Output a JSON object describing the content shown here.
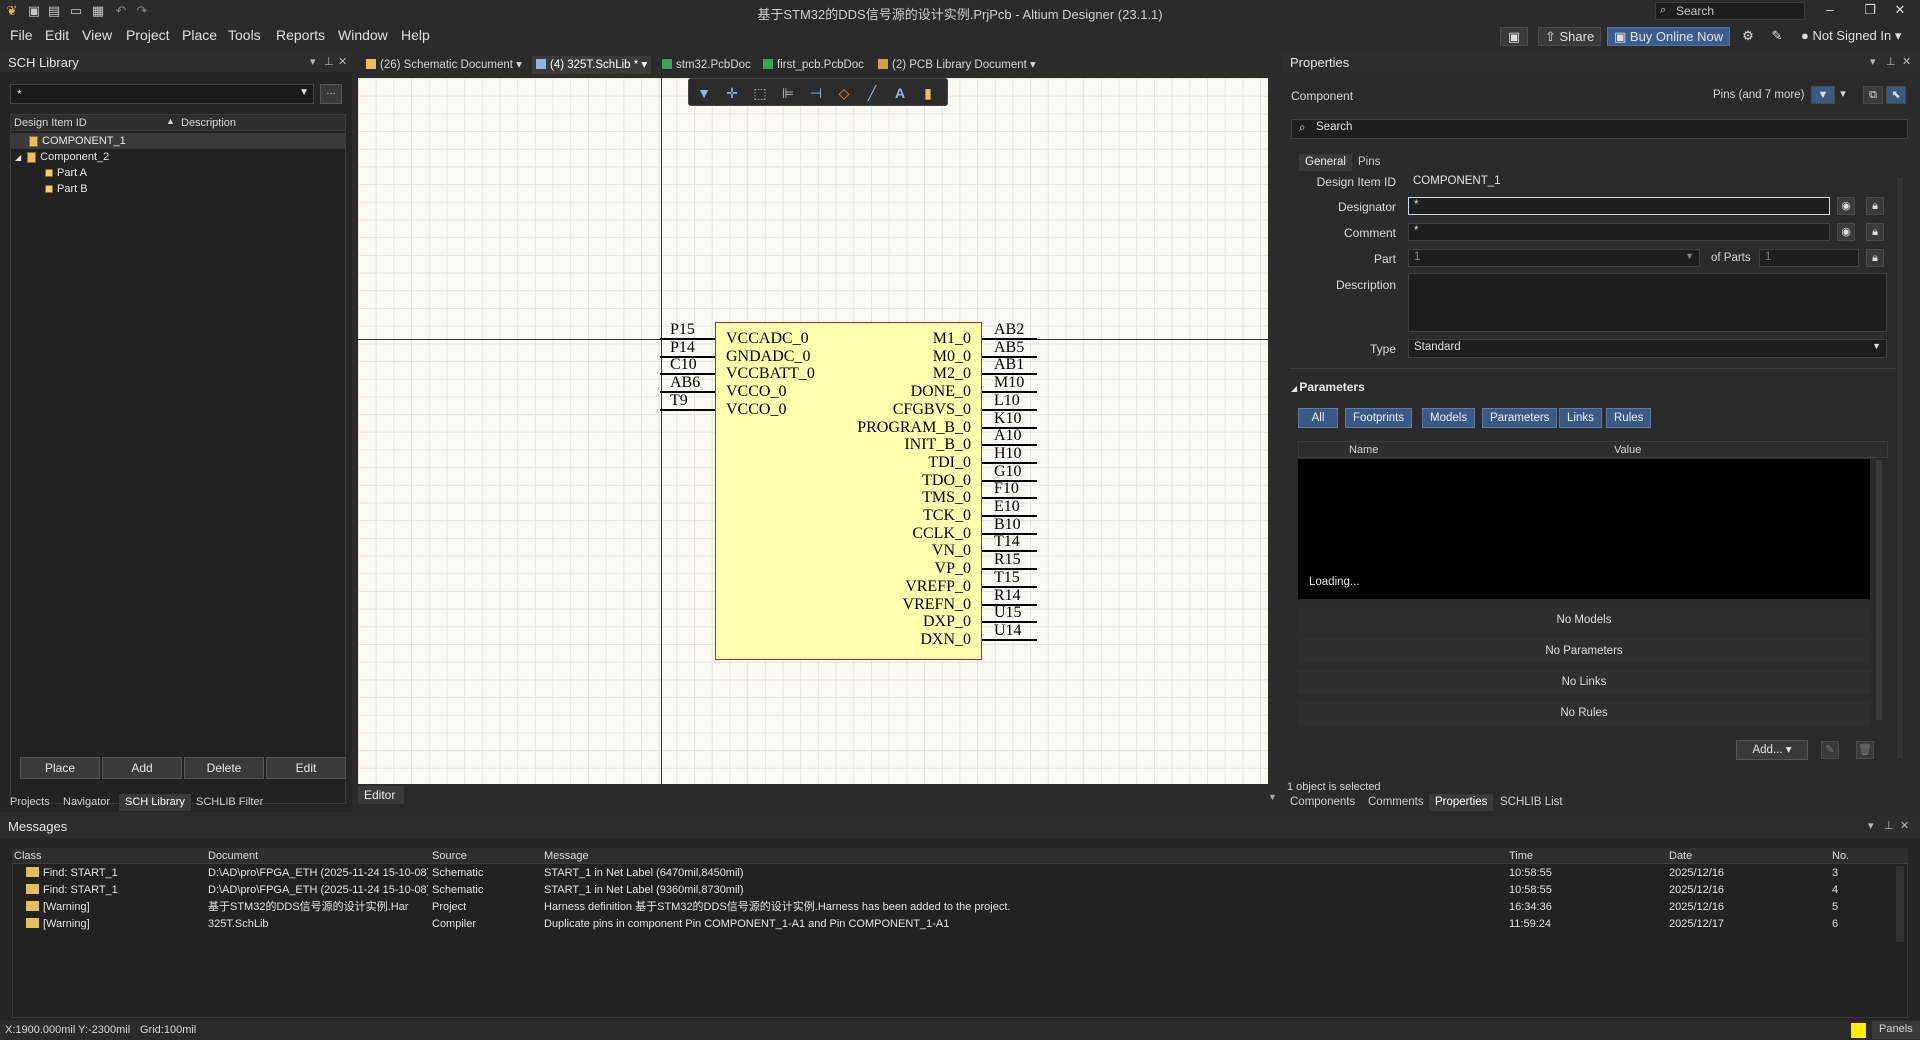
{
  "window": {
    "title": "基于STM32的DDS信号源的设计实例.PrjPcb - Altium Designer (23.1.1)",
    "search_placeholder": "Search"
  },
  "menu": [
    "File",
    "Edit",
    "View",
    "Project",
    "Place",
    "Tools",
    "Reports",
    "Window",
    "Help"
  ],
  "toolbar": {
    "share": "Share",
    "buy": "Buy Online Now",
    "account": "Not Signed In"
  },
  "left_panel": {
    "title": "SCH Library",
    "filter_value": "*",
    "filter_btn": "...",
    "columns": [
      "Design Item ID",
      "Description"
    ],
    "items": [
      {
        "label": "COMPONENT_1"
      },
      {
        "label": "Component_2"
      },
      {
        "label": "Part A"
      },
      {
        "label": "Part B"
      }
    ],
    "buttons": [
      "Place",
      "Add",
      "Delete",
      "Edit"
    ],
    "tabs": [
      "Projects",
      "Navigator",
      "SCH Library",
      "SCHLIB Filter"
    ]
  },
  "doc_tabs": [
    "(26) Schematic Document",
    "(4) 325T.SchLib *",
    "stm32.PcbDoc",
    "first_pcb.PcbDoc",
    "(2) PCB Library Document"
  ],
  "schematic": {
    "left_pin_numbers": [
      "P15",
      "P14",
      "C10",
      "AB6",
      "T9"
    ],
    "left_pin_names": [
      "VCCADC_0",
      "GNDADC_0",
      "VCCBATT_0",
      "VCCO_0",
      "VCCO_0"
    ],
    "right_pin_names": [
      "M1_0",
      "M0_0",
      "M2_0",
      "DONE_0",
      "CFGBVS_0",
      "PROGRAM_B_0",
      "INIT_B_0",
      "TDI_0",
      "TDO_0",
      "TMS_0",
      "TCK_0",
      "CCLK_0",
      "VN_0",
      "VP_0",
      "VREFP_0",
      "VREFN_0",
      "DXP_0",
      "DXN_0"
    ],
    "right_pin_numbers": [
      "AB2",
      "AB5",
      "AB1",
      "M10",
      "L10",
      "K10",
      "A10",
      "H10",
      "G10",
      "F10",
      "E10",
      "B10",
      "T14",
      "R15",
      "T15",
      "R14",
      "U15",
      "U14"
    ]
  },
  "editor_tab": "Editor",
  "properties": {
    "title": "Properties",
    "kind": "Component",
    "filter_label": "Pins (and 7 more)",
    "search_placeholder": "Search",
    "tabs": [
      "General",
      "Pins"
    ],
    "design_item_id_label": "Design Item ID",
    "design_item_id": "COMPONENT_1",
    "designator_label": "Designator",
    "designator": "*",
    "comment_label": "Comment",
    "comment": "*",
    "part_label": "Part",
    "part": "1",
    "of_parts_label": "of Parts",
    "of_parts": "1",
    "description_label": "Description",
    "type_label": "Type",
    "type": "Standard",
    "params_section": "Parameters",
    "filter_chips": [
      "All",
      "Footprints",
      "Models",
      "Parameters",
      "Links",
      "Rules"
    ],
    "grid_columns": [
      "Name",
      "Value"
    ],
    "loading": "Loading...",
    "no_models": "No Models",
    "no_parameters": "No Parameters",
    "no_links": "No Links",
    "no_rules": "No Rules",
    "add_button": "Add...",
    "selection_status": "1 object is selected",
    "bottom_tabs": [
      "Components",
      "Comments",
      "Properties",
      "SCHLIB List"
    ]
  },
  "messages": {
    "title": "Messages",
    "columns": [
      "Class",
      "Document",
      "Source",
      "Message",
      "Time",
      "Date",
      "No."
    ],
    "rows": [
      {
        "class": "Find: START_1",
        "document": "D:\\AD\\pro\\FPGA_ETH (2025-11-24 15-10-08)",
        "source": "Schematic",
        "message": "START_1 in Net Label (6470mil,8450mil)",
        "time": "10:58:55",
        "date": "2025/12/16",
        "no": "3"
      },
      {
        "class": "Find: START_1",
        "document": "D:\\AD\\pro\\FPGA_ETH (2025-11-24 15-10-08)",
        "source": "Schematic",
        "message": "START_1 in Net Label (9360mil,8730mil)",
        "time": "10:58:55",
        "date": "2025/12/16",
        "no": "4"
      },
      {
        "class": "[Warning]",
        "document": "基于STM32的DDS信号源的设计实例.Har",
        "source": "Project",
        "message": "Harness definition 基于STM32的DDS信号源的设计实例.Harness has been added to the project.",
        "time": "16:34:36",
        "date": "2025/12/16",
        "no": "5"
      },
      {
        "class": "[Warning]",
        "document": "325T.SchLib",
        "source": "Compiler",
        "message": "Duplicate pins in component Pin COMPONENT_1-A1 and Pin COMPONENT_1-A1",
        "time": "11:59:24",
        "date": "2025/12/17",
        "no": "6"
      }
    ]
  },
  "status": {
    "coords": "X:1900.000mil Y:-2300mil",
    "grid": "Grid:100mil",
    "panels": "Panels"
  }
}
